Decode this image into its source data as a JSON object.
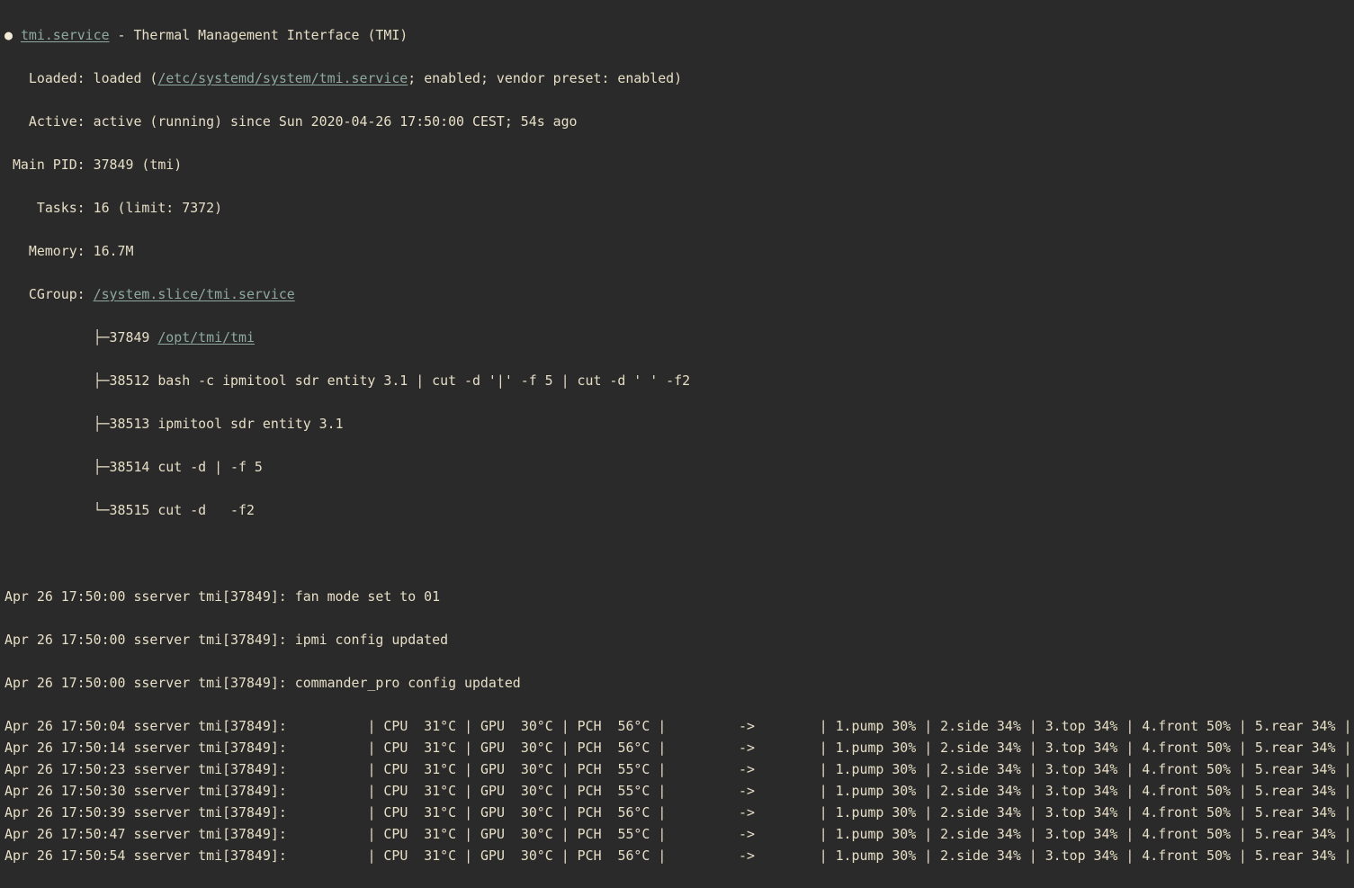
{
  "status": {
    "bullet": "●",
    "unit_name": "tmi.service",
    "description": " - Thermal Management Interface (TMI)",
    "loaded": {
      "label": "   Loaded: ",
      "prefix": "loaded (",
      "path": "/etc/systemd/system/tmi.service",
      "suffix": "; enabled; vendor preset: enabled)"
    },
    "active": {
      "label": "   Active: ",
      "value": "active (running) since Sun 2020-04-26 17:50:00 CEST; 54s ago"
    },
    "main_pid": {
      "label": " Main PID: ",
      "value": "37849 (tmi)"
    },
    "tasks": {
      "label": "    Tasks: ",
      "value": "16 (limit: 7372)"
    },
    "memory": {
      "label": "   Memory: ",
      "value": "16.7M"
    },
    "cgroup": {
      "label": "   CGroup: ",
      "path": "/system.slice/tmi.service",
      "processes": [
        {
          "branch": "           ├─",
          "pid": "37849",
          "command": "/opt/tmi/tmi",
          "is_link": true
        },
        {
          "branch": "           ├─",
          "pid": "38512",
          "command": "bash -c ipmitool sdr entity 3.1 | cut -d '|' -f 5 | cut -d ' ' -f2",
          "is_link": false
        },
        {
          "branch": "           ├─",
          "pid": "38513",
          "command": "ipmitool sdr entity 3.1",
          "is_link": false
        },
        {
          "branch": "           ├─",
          "pid": "38514",
          "command": "cut -d | -f 5",
          "is_link": false
        },
        {
          "branch": "           └─",
          "pid": "38515",
          "command": "cut -d   -f2",
          "is_link": false
        }
      ]
    }
  },
  "log": {
    "messages": [
      "Apr 26 17:50:00 sserver tmi[37849]: fan mode set to 01",
      "Apr 26 17:50:00 sserver tmi[37849]: ipmi config updated",
      "Apr 26 17:50:00 sserver tmi[37849]: commander_pro config updated"
    ],
    "readings": [
      {
        "time": "17:50:04",
        "cpu": "31°C",
        "gpu": "30°C",
        "pch": "56°C",
        "pump": "30%",
        "side": "34%",
        "top": "34%",
        "front": "50%",
        "rear": "34%"
      },
      {
        "time": "17:50:14",
        "cpu": "31°C",
        "gpu": "30°C",
        "pch": "56°C",
        "pump": "30%",
        "side": "34%",
        "top": "34%",
        "front": "50%",
        "rear": "34%"
      },
      {
        "time": "17:50:23",
        "cpu": "31°C",
        "gpu": "30°C",
        "pch": "55°C",
        "pump": "30%",
        "side": "34%",
        "top": "34%",
        "front": "50%",
        "rear": "34%"
      },
      {
        "time": "17:50:30",
        "cpu": "31°C",
        "gpu": "30°C",
        "pch": "55°C",
        "pump": "30%",
        "side": "34%",
        "top": "34%",
        "front": "50%",
        "rear": "34%"
      },
      {
        "time": "17:50:39",
        "cpu": "31°C",
        "gpu": "30°C",
        "pch": "56°C",
        "pump": "30%",
        "side": "34%",
        "top": "34%",
        "front": "50%",
        "rear": "34%"
      },
      {
        "time": "17:50:47",
        "cpu": "31°C",
        "gpu": "30°C",
        "pch": "55°C",
        "pump": "30%",
        "side": "34%",
        "top": "34%",
        "front": "50%",
        "rear": "34%"
      },
      {
        "time": "17:50:54",
        "cpu": "31°C",
        "gpu": "30°C",
        "pch": "56°C",
        "pump": "30%",
        "side": "34%",
        "top": "34%",
        "front": "50%",
        "rear": "34%"
      }
    ],
    "reading_prefix": "Apr 26 ",
    "reading_host": " sserver tmi[37849]:",
    "labels": {
      "cpu": "CPU",
      "gpu": "GPU",
      "pch": "PCH",
      "arrow": "->",
      "pump": "1.pump",
      "side": "2.side",
      "top": "3.top",
      "front": "4.front",
      "rear": "5.rear"
    }
  },
  "colors": {
    "background": "#2a2a2a",
    "text": "#e7dec6",
    "link": "#8fa9a1"
  }
}
